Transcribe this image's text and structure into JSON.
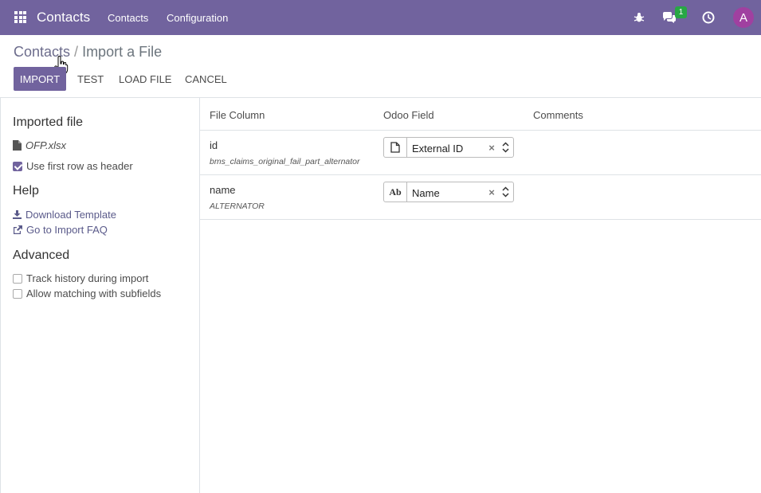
{
  "navbar": {
    "brand": "Contacts",
    "menus": [
      "Contacts",
      "Configuration"
    ],
    "message_count": "1",
    "avatar_letter": "A",
    "bg_color": "#71639e"
  },
  "breadcrumb": {
    "parent": "Contacts",
    "separator": "/",
    "current": "Import a File"
  },
  "toolbar": {
    "import_label": "IMPORT",
    "test_label": "TEST",
    "load_file_label": "LOAD FILE",
    "cancel_label": "CANCEL"
  },
  "sidebar": {
    "imported_file_heading": "Imported file",
    "file_name": "OFP.xlsx",
    "use_first_row_label": "Use first row as header",
    "use_first_row_checked": true,
    "help_heading": "Help",
    "download_template_label": "Download Template",
    "import_faq_label": "Go to Import FAQ",
    "advanced_heading": "Advanced",
    "track_history_label": "Track history during import",
    "track_history_checked": false,
    "allow_matching_label": "Allow matching with subfields",
    "allow_matching_checked": false
  },
  "table": {
    "headers": {
      "file_column": "File Column",
      "odoo_field": "Odoo Field",
      "comments": "Comments"
    },
    "rows": [
      {
        "column": "id",
        "sample": "bms_claims_original_fail_part_alternator",
        "field_icon": "file-icon",
        "field": "External ID"
      },
      {
        "column": "name",
        "sample": "ALTERNATOR",
        "field_icon": "text-icon",
        "field_icon_text": "Ab",
        "field": "Name"
      }
    ]
  }
}
